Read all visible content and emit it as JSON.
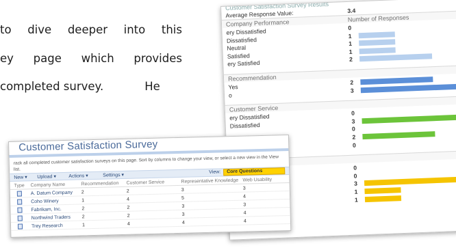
{
  "document": {
    "line1": [
      "to",
      "dive",
      "deeper",
      "into",
      "this"
    ],
    "line2": [
      "ey",
      "page",
      "which",
      "provides"
    ],
    "line3": [
      "completed survey.",
      "He"
    ]
  },
  "survey_results": {
    "title_partial": "Customer Satisfaction Survey Results",
    "average_label": "Average Response Value:",
    "average_value": "3.4",
    "col_header": "Number of Responses",
    "colors": {
      "blue_light": "#b7d0ee",
      "blue": "#5b8fd8",
      "green": "#6cc43a",
      "yellow": "#f5c400"
    },
    "sections": [
      {
        "name": "Company Performance",
        "rows": [
          {
            "label": "ery Dissatisfied",
            "value": "0",
            "fraction": 0,
            "color": "#b7d0ee"
          },
          {
            "label": "Dissatisfied",
            "value": "1",
            "fraction": 0.33,
            "color": "#b7d0ee"
          },
          {
            "label": "Neutral",
            "value": "1",
            "fraction": 0.33,
            "color": "#b7d0ee"
          },
          {
            "label": "Satisfied",
            "value": "1",
            "fraction": 0.33,
            "color": "#b7d0ee"
          },
          {
            "label": "ery Satisfied",
            "value": "2",
            "fraction": 0.66,
            "color": "#b7d0ee"
          }
        ]
      },
      {
        "name": "Recommendation",
        "rows": [
          {
            "label": "Yes",
            "value": "2",
            "fraction": 0.66,
            "color": "#5b8fd8"
          },
          {
            "label": "o",
            "value": "3",
            "fraction": 1.0,
            "color": "#5b8fd8"
          }
        ]
      },
      {
        "name": "Customer Service",
        "rows": [
          {
            "label": "ery Dissatisfied",
            "value": "0",
            "fraction": 0,
            "color": "#6cc43a"
          },
          {
            "label": "Dissatisfied",
            "value": "3",
            "fraction": 1.0,
            "color": "#6cc43a"
          },
          {
            "label": "",
            "value": "0",
            "fraction": 0,
            "color": "#6cc43a"
          },
          {
            "label": "",
            "value": "2",
            "fraction": 0.66,
            "color": "#6cc43a"
          },
          {
            "label": "",
            "value": "0",
            "fraction": 0,
            "color": "#6cc43a"
          }
        ]
      },
      {
        "name": "wledge",
        "rows": [
          {
            "label": "",
            "value": "0",
            "fraction": 0,
            "color": "#f5c400"
          },
          {
            "label": "",
            "value": "0",
            "fraction": 0,
            "color": "#f5c400"
          },
          {
            "label": "",
            "value": "3",
            "fraction": 1.0,
            "color": "#f5c400"
          },
          {
            "label": "",
            "value": "1",
            "fraction": 0.33,
            "color": "#f5c400"
          },
          {
            "label": "",
            "value": "1",
            "fraction": 0.33,
            "color": "#f5c400"
          }
        ]
      }
    ]
  },
  "survey_list": {
    "title": "Customer Satisfaction Survey",
    "description": "rack all completed customer satisfaction surveys on this page. Sort by columns to change your view, or select a new view in the View list.",
    "toolbar": {
      "new": "New",
      "upload": "Upload",
      "actions": "Actions",
      "settings": "Settings",
      "view_label": "View:",
      "view_value": "Core Questions"
    },
    "columns": [
      "Type",
      "Company Name",
      "Recommendation",
      "Customer Service",
      "Representative Knowledge",
      "Web Usability"
    ],
    "rows": [
      [
        "A. Datum Company",
        "2",
        "2",
        "3",
        "3"
      ],
      [
        "Coho Winery",
        "1",
        "4",
        "5",
        "4"
      ],
      [
        "Fabrikam, Inc.",
        "2",
        "2",
        "3",
        "3"
      ],
      [
        "Northwind Traders",
        "2",
        "2",
        "3",
        "4"
      ],
      [
        "Trey Research",
        "1",
        "4",
        "4",
        "4"
      ]
    ]
  }
}
